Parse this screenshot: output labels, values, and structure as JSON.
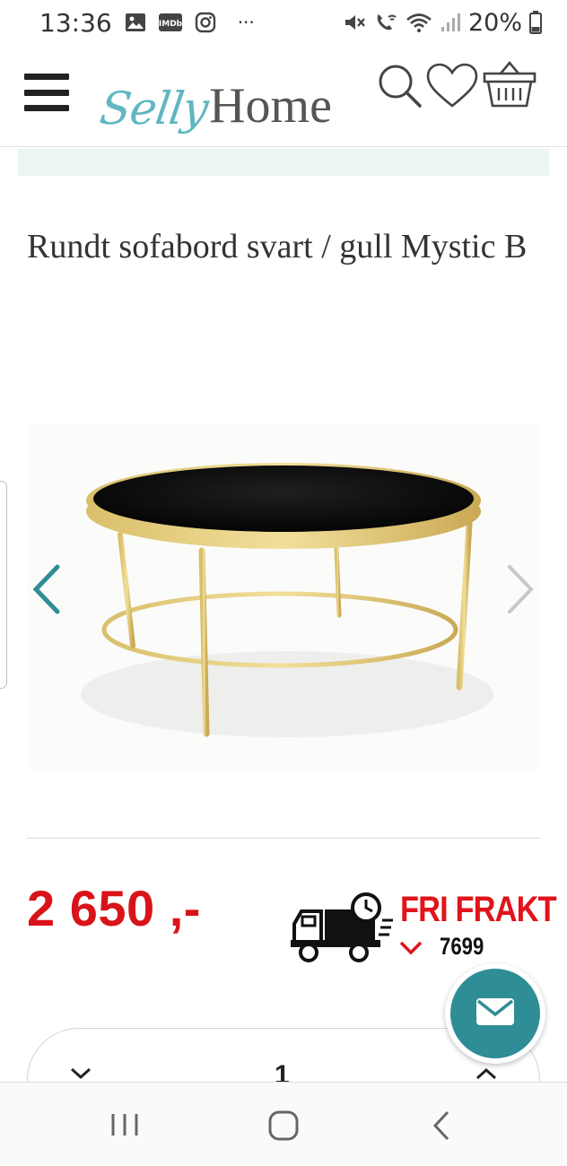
{
  "status_bar": {
    "time": "13:36",
    "battery_percent": "20%",
    "more": "···",
    "icons_left": [
      "gallery-icon",
      "imdb-icon",
      "instagram-icon"
    ],
    "icons_right": [
      "mute-icon",
      "wifi-call-icon",
      "wifi-icon",
      "signal-icon",
      "battery-icon"
    ]
  },
  "header": {
    "logo_script": "Selly",
    "logo_serif": "Home",
    "accent_color": "#5fb7c0",
    "icons": [
      "menu-icon",
      "search-icon",
      "heart-icon",
      "basket-icon"
    ]
  },
  "product": {
    "title": "Rundt sofabord svart / gull Mystic B",
    "price": "2 650 ,-",
    "price_color": "#d8141a"
  },
  "shipping": {
    "label": "FRI FRAKT",
    "code": "7699",
    "label_color": "#e0141b"
  },
  "quantity": {
    "value": "1"
  },
  "fab": {
    "icon": "mail-icon",
    "color": "#2f8d95"
  },
  "nav_bar": {
    "icons": [
      "recent-apps-icon",
      "home-icon",
      "back-icon"
    ]
  }
}
